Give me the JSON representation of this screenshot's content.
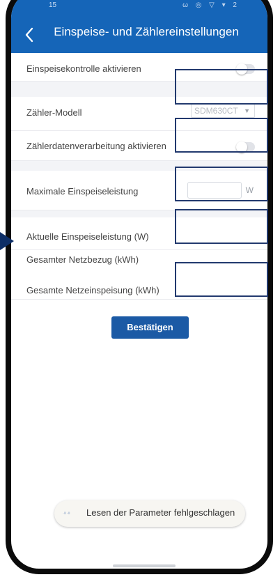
{
  "header": {
    "title": "Einspeise- und Zählereinstellungen",
    "back_icon": "chevron-left-icon",
    "background": "#1565b8",
    "status_left": "15",
    "status_right": "ω ◎ ▽ ▾ 2"
  },
  "settings": {
    "feed_control_label": "Einspeisekontrolle aktivieren",
    "meter_model_label": "Zähler-Modell",
    "meter_model_value": "SDM630CT",
    "meter_processing_label": "Zählerdatenverarbeitung aktivieren",
    "max_feed_label": "Maximale Einspeiseleistung",
    "max_feed_value": "",
    "max_feed_unit": "W",
    "current_feed_label": "Aktuelle Einspeiseleistung (W)",
    "grid_import_label": "Gesamter Netzbezug (kWh)",
    "grid_export_label": "Gesamte Netzeinspeisung (kWh)"
  },
  "actions": {
    "confirm_label": "Bestätigen",
    "confirm_color": "#1b5aa5"
  },
  "toast": {
    "message": "Lesen der Parameter fehlgeschlagen",
    "icon_text": "·ıı·ıı"
  },
  "annotation": {
    "box_color": "#22396e",
    "arrow_color": "#0d2e66"
  }
}
